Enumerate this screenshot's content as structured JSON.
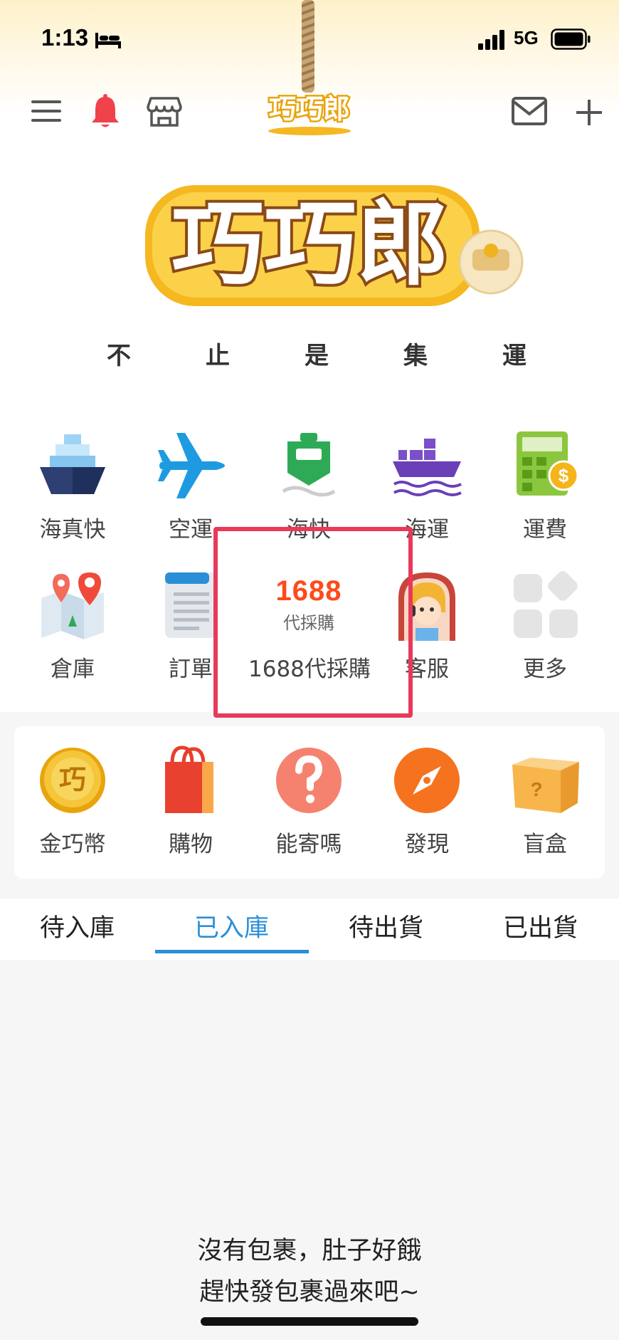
{
  "status_bar": {
    "time": "1:13",
    "network": "5G"
  },
  "nav": {
    "logo_text": "巧巧郎"
  },
  "hero": {
    "logo_text": "巧巧郎",
    "slogan": [
      "不",
      "止",
      "是",
      "集",
      "運"
    ]
  },
  "services_row1": [
    {
      "label": "海真快",
      "icon": "ship-icon"
    },
    {
      "label": "空運",
      "icon": "airplane-icon"
    },
    {
      "label": "海快",
      "icon": "ferry-icon"
    },
    {
      "label": "海運",
      "icon": "cargo-ship-icon"
    },
    {
      "label": "運費",
      "icon": "calculator-icon"
    }
  ],
  "services_row2": [
    {
      "label": "倉庫",
      "icon": "map-pin-icon"
    },
    {
      "label": "訂單",
      "icon": "document-icon"
    },
    {
      "label": "1688代採購",
      "icon": "logo-1688-icon",
      "logo_number": "1688",
      "logo_sub": "代採購"
    },
    {
      "label": "客服",
      "icon": "customer-service-icon"
    },
    {
      "label": "更多",
      "icon": "more-grid-icon"
    }
  ],
  "features": [
    {
      "label": "金巧幣",
      "icon": "coin-icon",
      "coin_text": "巧"
    },
    {
      "label": "購物",
      "icon": "shopping-bag-icon"
    },
    {
      "label": "能寄嗎",
      "icon": "question-icon"
    },
    {
      "label": "發現",
      "icon": "compass-icon"
    },
    {
      "label": "盲盒",
      "icon": "mystery-box-icon"
    }
  ],
  "tabs": [
    {
      "label": "待入庫",
      "active": false
    },
    {
      "label": "已入庫",
      "active": true
    },
    {
      "label": "待出貨",
      "active": false
    },
    {
      "label": "已出貨",
      "active": false
    }
  ],
  "empty_state": {
    "line1": "沒有包裹，肚子好餓",
    "line2": "趕快發包裹過來吧~"
  },
  "colors": {
    "accent": "#2a8fd6",
    "highlight": "#e8395a",
    "logo_yellow": "#f5b820",
    "bell_red": "#f0424a"
  }
}
